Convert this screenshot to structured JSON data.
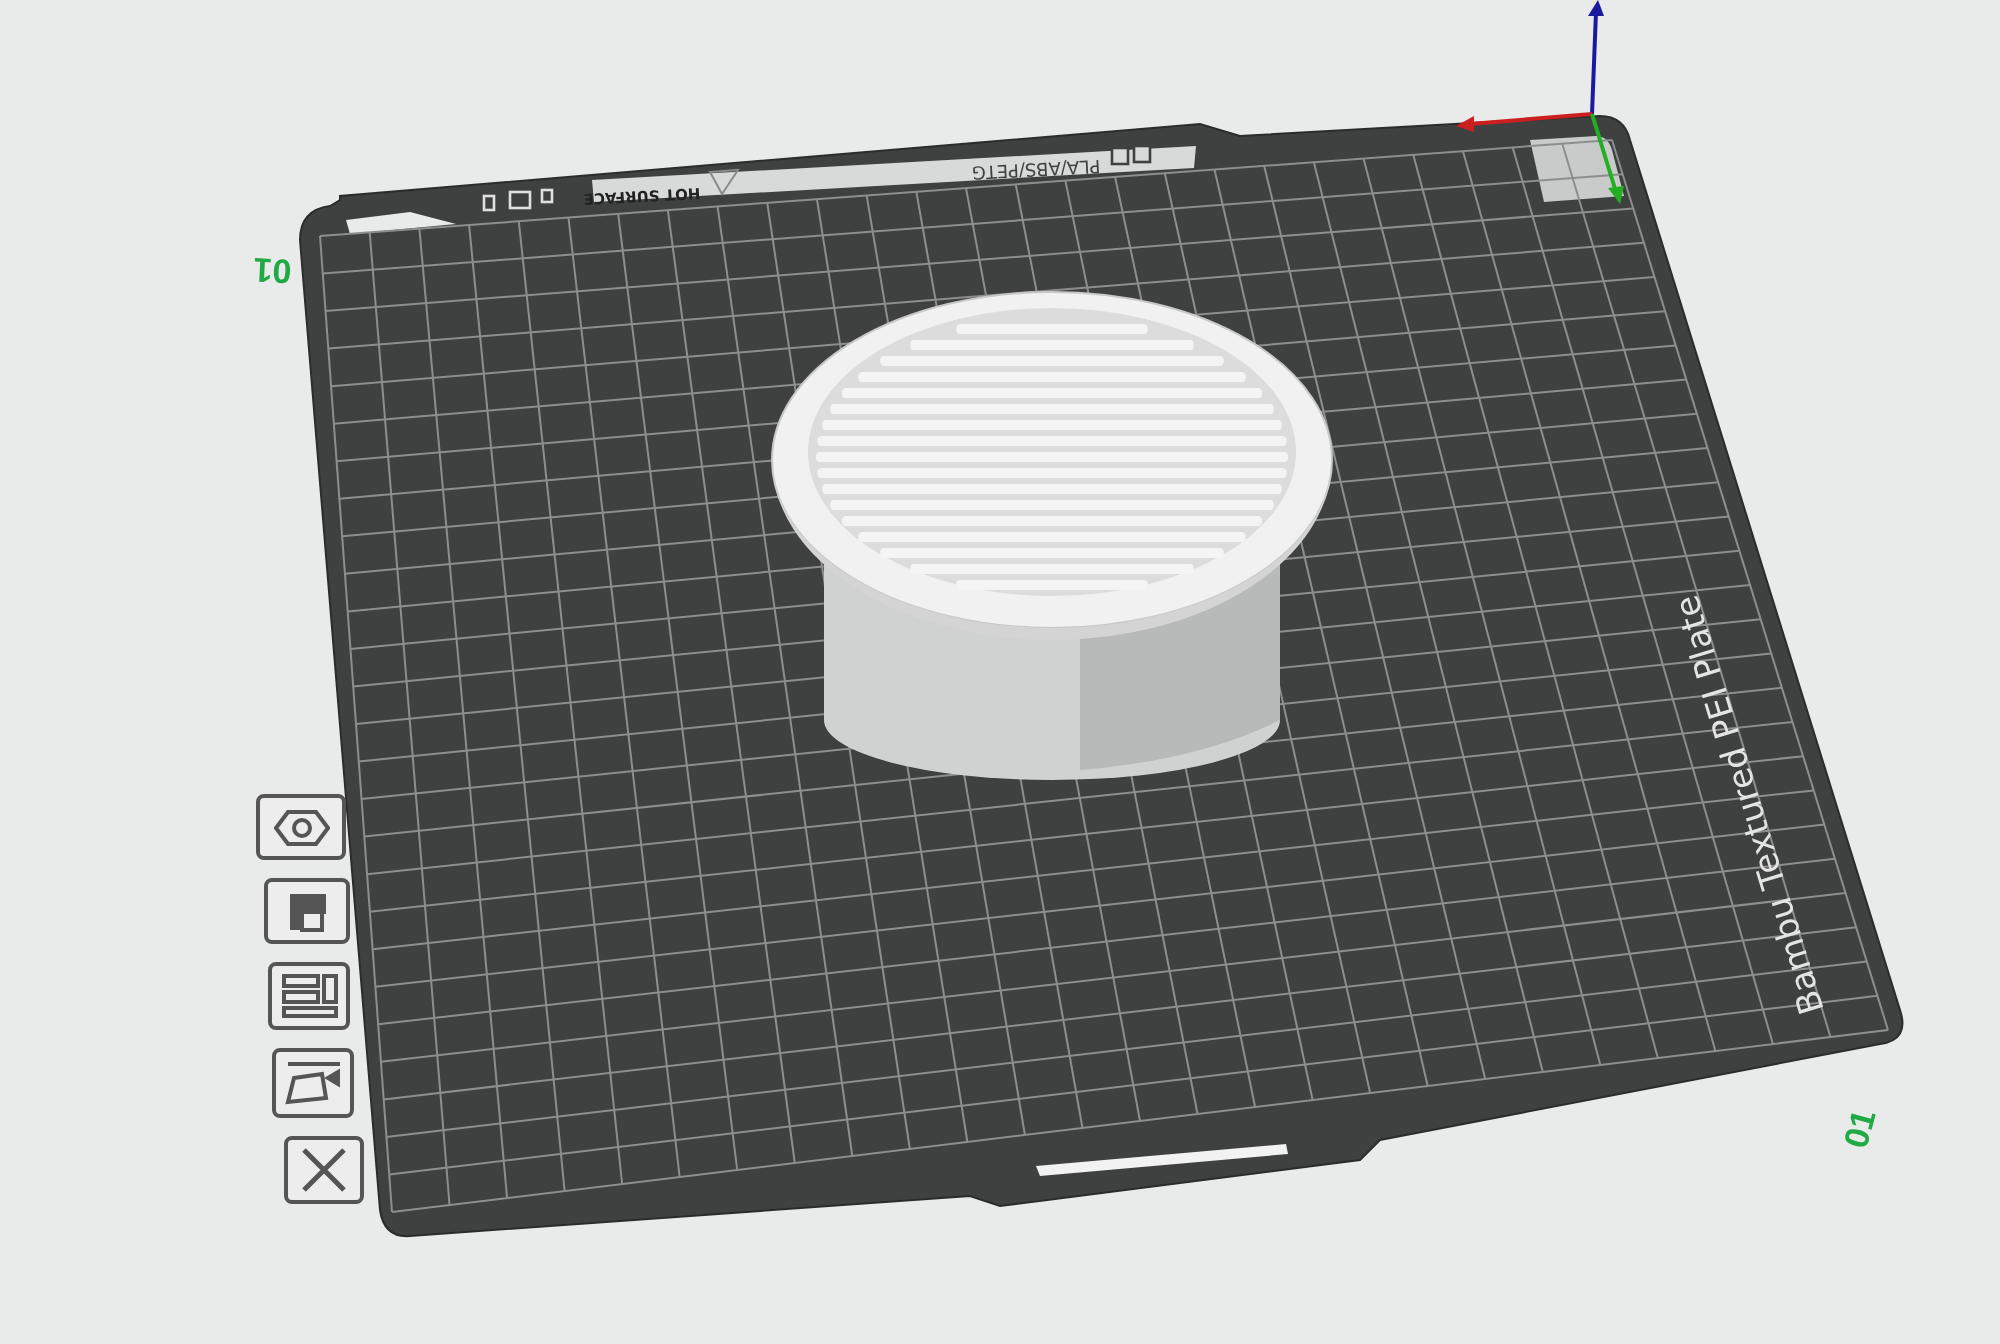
{
  "plate": {
    "name_label": "Bambu Textured PEI Plate",
    "filament_label": "PLA/ABS/PETG",
    "warning_label": "HOT SURFACE"
  },
  "plate_numbers": [
    {
      "text": "01"
    },
    {
      "text": "01"
    }
  ]
}
